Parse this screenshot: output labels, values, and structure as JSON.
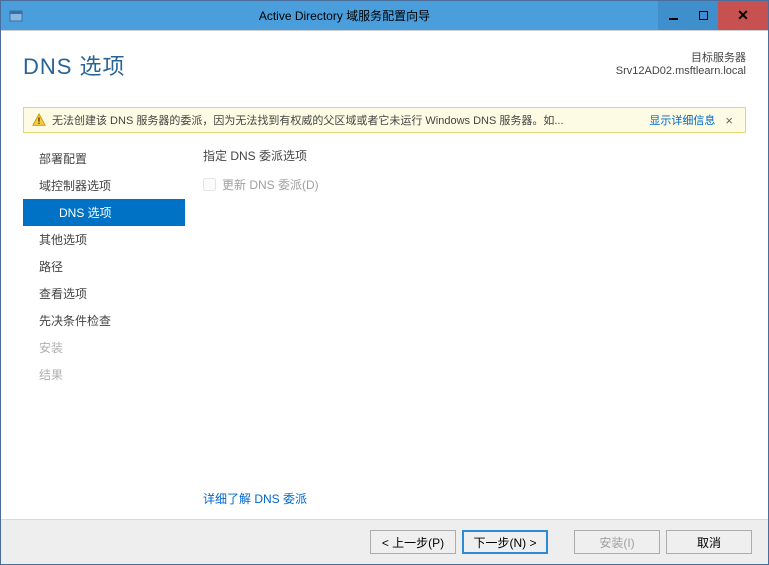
{
  "window": {
    "title": "Active Directory 域服务配置向导"
  },
  "wizard": {
    "title": "DNS 选项",
    "target_label": "目标服务器",
    "target_server": "Srv12AD02.msftlearn.local"
  },
  "warning": {
    "text": "无法创建该 DNS 服务器的委派，因为无法找到有权威的父区域或者它未运行 Windows DNS 服务器。如...",
    "link": "显示详细信息",
    "close": "×"
  },
  "nav": {
    "items": [
      {
        "label": "部署配置",
        "state": "link"
      },
      {
        "label": "域控制器选项",
        "state": "link"
      },
      {
        "label": "DNS 选项",
        "state": "active"
      },
      {
        "label": "其他选项",
        "state": "link"
      },
      {
        "label": "路径",
        "state": "link"
      },
      {
        "label": "查看选项",
        "state": "link"
      },
      {
        "label": "先决条件检查",
        "state": "link"
      },
      {
        "label": "安装",
        "state": "disabled"
      },
      {
        "label": "结果",
        "state": "disabled"
      }
    ]
  },
  "content": {
    "section_title": "指定 DNS 委派选项",
    "checkbox_label": "更新 DNS 委派(D)",
    "more_link": "详细了解 DNS 委派"
  },
  "footer": {
    "prev": "< 上一步(P)",
    "next": "下一步(N) >",
    "install": "安装(I)",
    "cancel": "取消"
  }
}
